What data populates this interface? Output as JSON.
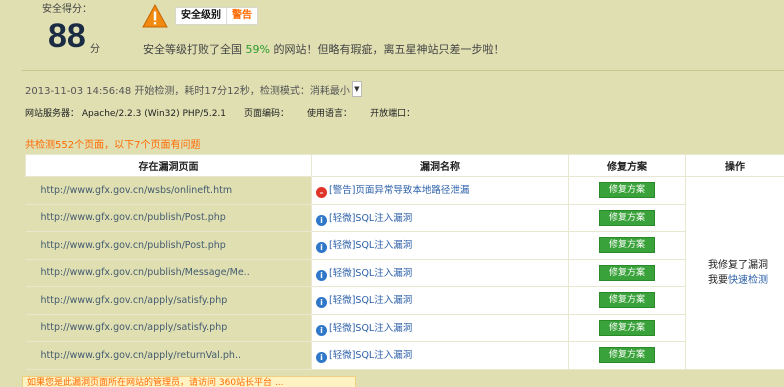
{
  "score": {
    "label": "安全得分：",
    "value": "88",
    "unit": "分"
  },
  "level": {
    "label": "安全级别",
    "value": "警告"
  },
  "message": {
    "prefix": "安全等级打败了全国 ",
    "percent": "59%",
    "suffix": " 的网站！但略有瑕疵，离五星神站只差一步啦！"
  },
  "scan_info": {
    "text": "2013-11-03 14:56:48 开始检测，耗时17分12秒，检测模式：消耗最小",
    "dropdown_icon": "chevron-down-icon"
  },
  "server_info": {
    "server": "网站服务器：  Apache/2.2.3 (Win32) PHP/5.2.1",
    "encoding": "页面编码：",
    "language": "使用语言：",
    "ports": "开放端口："
  },
  "summary": "共检测552个页面，以下7个页面有问题",
  "table": {
    "headers": [
      "存在漏洞页面",
      "漏洞名称",
      "修复方案",
      "操作"
    ],
    "fix_label": "修复方案",
    "rows": [
      {
        "url": "http://www.gfx.gov.cn/wsbs/onlineft.htm",
        "severity": "error",
        "name": "[警告]页面异常导致本地路径泄漏"
      },
      {
        "url": "http://www.gfx.gov.cn/publish/Post.php",
        "severity": "info",
        "name": "[轻微]SQL注入漏洞"
      },
      {
        "url": "http://www.gfx.gov.cn/publish/Post.php",
        "severity": "info",
        "name": "[轻微]SQL注入漏洞"
      },
      {
        "url": "http://www.gfx.gov.cn/publish/Message/Me..",
        "severity": "info",
        "name": "[轻微]SQL注入漏洞"
      },
      {
        "url": "http://www.gfx.gov.cn/apply/satisfy.php",
        "severity": "info",
        "name": "[轻微]SQL注入漏洞"
      },
      {
        "url": "http://www.gfx.gov.cn/apply/satisfy.php",
        "severity": "info",
        "name": "[轻微]SQL注入漏洞"
      },
      {
        "url": "http://www.gfx.gov.cn/apply/returnVal.ph..",
        "severity": "info",
        "name": "[轻微]SQL注入漏洞"
      }
    ],
    "op_fixed": "我修复了漏洞",
    "op_quick_prefix": "我要",
    "op_quick_link": "快速检测"
  },
  "notice": "如果您是此漏洞页面所在网站的管理员，请访问 360站长平台 ..."
}
